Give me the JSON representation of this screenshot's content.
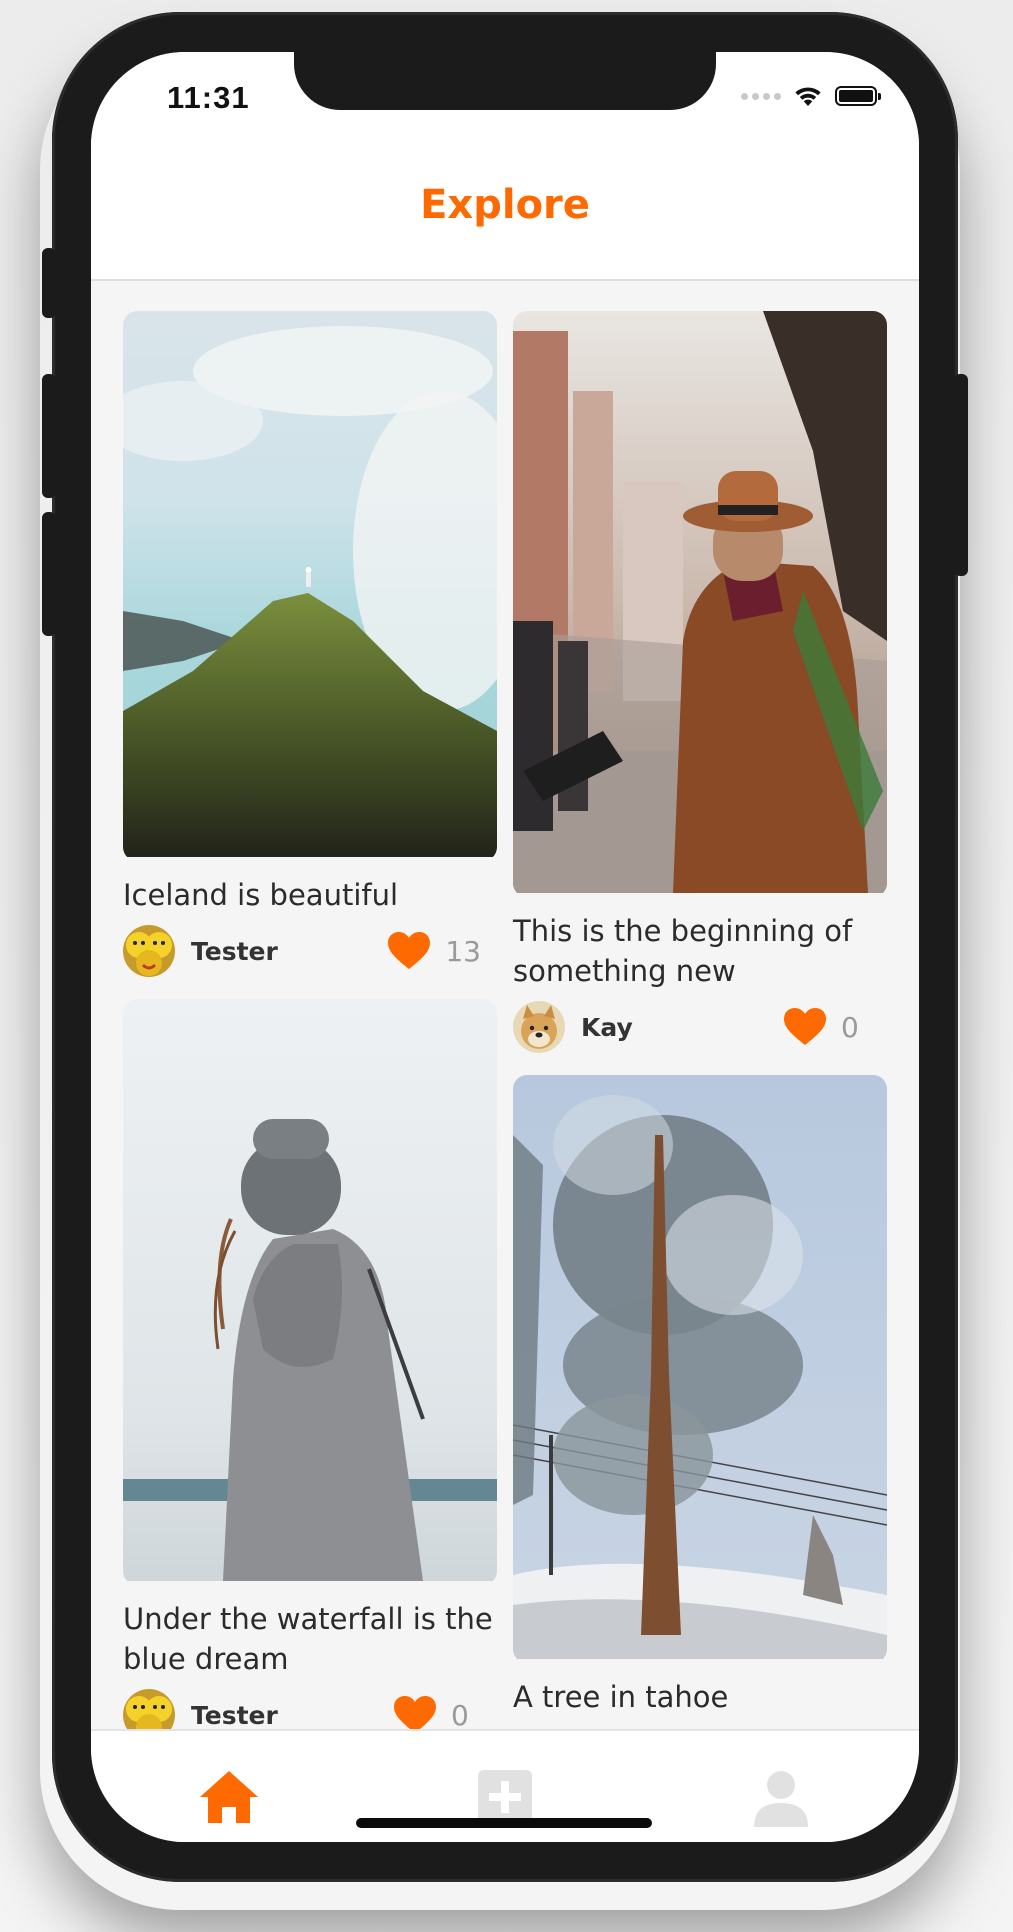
{
  "app": {
    "title": "Explore",
    "accent_color": "#ff6a00"
  },
  "status_bar": {
    "time": "11:31",
    "icons": [
      "signal-dots-icon",
      "wifi-icon",
      "battery-icon"
    ]
  },
  "posts": [
    {
      "caption": "Iceland is beautiful",
      "author": "Tester",
      "likes": "13",
      "avatar": "smiley-avatar",
      "image": "iceland-mountain-photo"
    },
    {
      "caption": "This is the beginning of something new",
      "author": "Kay",
      "likes": "0",
      "avatar": "doge-avatar",
      "image": "street-musician-photo"
    },
    {
      "caption": "Under the waterfall is the blue dream",
      "author": "Tester",
      "likes": "0",
      "avatar": "smiley-avatar",
      "image": "grey-sweater-photo"
    },
    {
      "caption": "A tree in tahoe",
      "author": "",
      "likes": "",
      "avatar": "",
      "image": "snowy-tree-photo"
    }
  ],
  "tab_bar": {
    "tabs": [
      {
        "icon": "home-icon",
        "active": true
      },
      {
        "icon": "add-post-icon",
        "active": false
      },
      {
        "icon": "profile-icon",
        "active": false
      }
    ]
  }
}
